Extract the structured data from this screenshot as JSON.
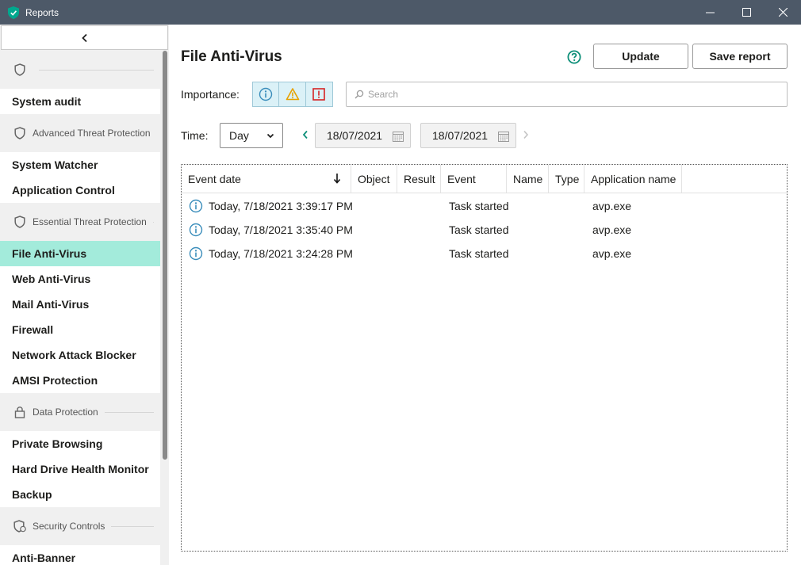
{
  "window": {
    "title": "Reports",
    "brand_color": "#00a88e",
    "titlebar_color": "#4d5968"
  },
  "sidebar": {
    "collapse_icon": "chevron-left-icon",
    "sections": [
      {
        "type": "group",
        "label": "",
        "icon": "shield-icon"
      },
      {
        "type": "item",
        "label": "System audit"
      },
      {
        "type": "group",
        "label": "Advanced Threat Protection",
        "icon": "shield-icon"
      },
      {
        "type": "item",
        "label": "System Watcher"
      },
      {
        "type": "item",
        "label": "Application Control"
      },
      {
        "type": "group",
        "label": "Essential Threat Protection",
        "icon": "shield-icon"
      },
      {
        "type": "item",
        "label": "File Anti-Virus",
        "active": true
      },
      {
        "type": "item",
        "label": "Web Anti-Virus"
      },
      {
        "type": "item",
        "label": "Mail Anti-Virus"
      },
      {
        "type": "item",
        "label": "Firewall"
      },
      {
        "type": "item",
        "label": "Network Attack Blocker"
      },
      {
        "type": "item",
        "label": "AMSI Protection"
      },
      {
        "type": "group",
        "label": "Data Protection",
        "icon": "lock-icon"
      },
      {
        "type": "item",
        "label": "Private Browsing"
      },
      {
        "type": "item",
        "label": "Hard Drive Health Monitor"
      },
      {
        "type": "item",
        "label": "Backup"
      },
      {
        "type": "group",
        "label": "Security Controls",
        "icon": "shield-check-icon"
      },
      {
        "type": "item",
        "label": "Anti-Banner"
      }
    ],
    "active_color": "#a3ebdb"
  },
  "main": {
    "title": "File Anti-Virus",
    "update_label": "Update",
    "save_label": "Save report",
    "importance_label": "Importance:",
    "importance_buttons": [
      {
        "icon": "info-icon",
        "color": "#3a8dbb"
      },
      {
        "icon": "warning-icon",
        "color": "#e6a100"
      },
      {
        "icon": "critical-icon",
        "color": "#d62424"
      }
    ],
    "search_placeholder": "Search",
    "time_label": "Time:",
    "time_value": "Day",
    "date_from": "18/07/2021",
    "date_to": "18/07/2021"
  },
  "table": {
    "columns": [
      "Event date",
      "Object",
      "Result",
      "Event",
      "Name",
      "Type",
      "Application name"
    ],
    "sort_column": "Event date",
    "rows": [
      {
        "icon": "info-icon",
        "event_date": "Today, 7/18/2021 3:39:17 PM",
        "object": "",
        "result": "",
        "event": "Task started",
        "name": "",
        "type": "",
        "application": "avp.exe"
      },
      {
        "icon": "info-icon",
        "event_date": "Today, 7/18/2021 3:35:40 PM",
        "object": "",
        "result": "",
        "event": "Task started",
        "name": "",
        "type": "",
        "application": "avp.exe"
      },
      {
        "icon": "info-icon",
        "event_date": "Today, 7/18/2021 3:24:28 PM",
        "object": "",
        "result": "",
        "event": "Task started",
        "name": "",
        "type": "",
        "application": "avp.exe"
      }
    ]
  }
}
